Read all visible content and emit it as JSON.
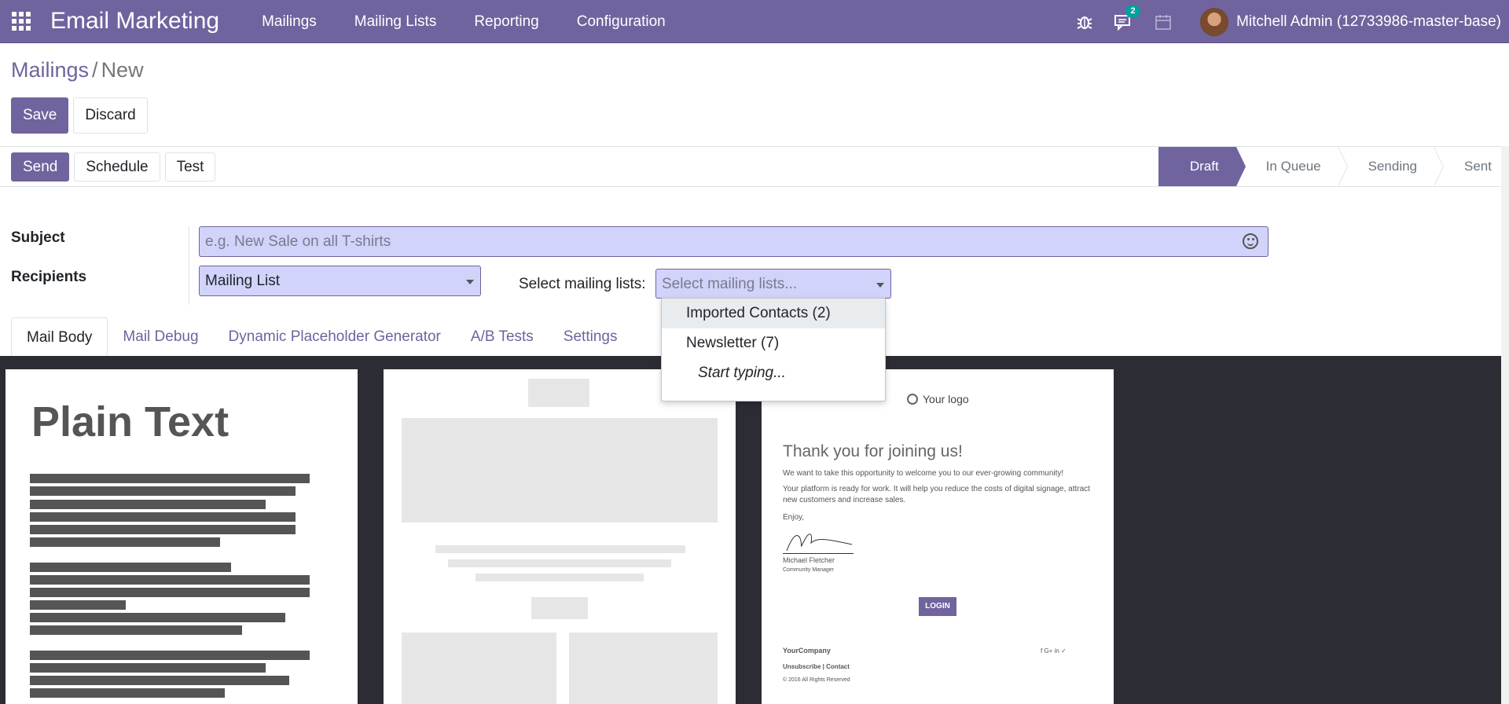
{
  "navbar": {
    "app_title": "Email Marketing",
    "menu": [
      "Mailings",
      "Mailing Lists",
      "Reporting",
      "Configuration"
    ],
    "chat_badge": "2",
    "user": "Mitchell Admin (12733986-master-base)",
    "accent_color": "#71639e"
  },
  "breadcrumb": {
    "parent": "Mailings",
    "separator": "/",
    "current": "New"
  },
  "buttons": {
    "save": "Save",
    "discard": "Discard",
    "send": "Send",
    "schedule": "Schedule",
    "test": "Test"
  },
  "stages": [
    "Draft",
    "In Queue",
    "Sending",
    "Sent"
  ],
  "active_stage": "Draft",
  "form": {
    "subject_label": "Subject",
    "subject_placeholder": "e.g. New Sale on all T-shirts",
    "recipients_label": "Recipients",
    "recipients_value": "Mailing List",
    "mailing_lists_label": "Select mailing lists:",
    "mailing_lists_placeholder": "Select mailing lists..."
  },
  "dropdown": {
    "items": [
      "Imported Contacts (2)",
      "Newsletter (7)"
    ],
    "hint": "Start typing..."
  },
  "tabs": [
    "Mail Body",
    "Mail Debug",
    "Dynamic Placeholder Generator",
    "A/B Tests",
    "Settings"
  ],
  "templates": {
    "plain_text_title": "Plain Text",
    "welcome": {
      "logo": "Your logo",
      "title": "Thank you for joining us!",
      "line1": "We want to take this opportunity to welcome you to our ever-growing community!",
      "line2": "Your platform is ready for work. It will help you reduce the costs of digital signage, attract new customers and increase sales.",
      "line3": "Enjoy,",
      "signer": "Michael Fletcher",
      "signer_role": "Community Manager",
      "login": "LOGIN",
      "company": "YourCompany",
      "footer_links": "Unsubscribe | Contact",
      "copyright": "© 2016 All Rights Reserved",
      "social": "f  G+  in  ✓"
    }
  }
}
